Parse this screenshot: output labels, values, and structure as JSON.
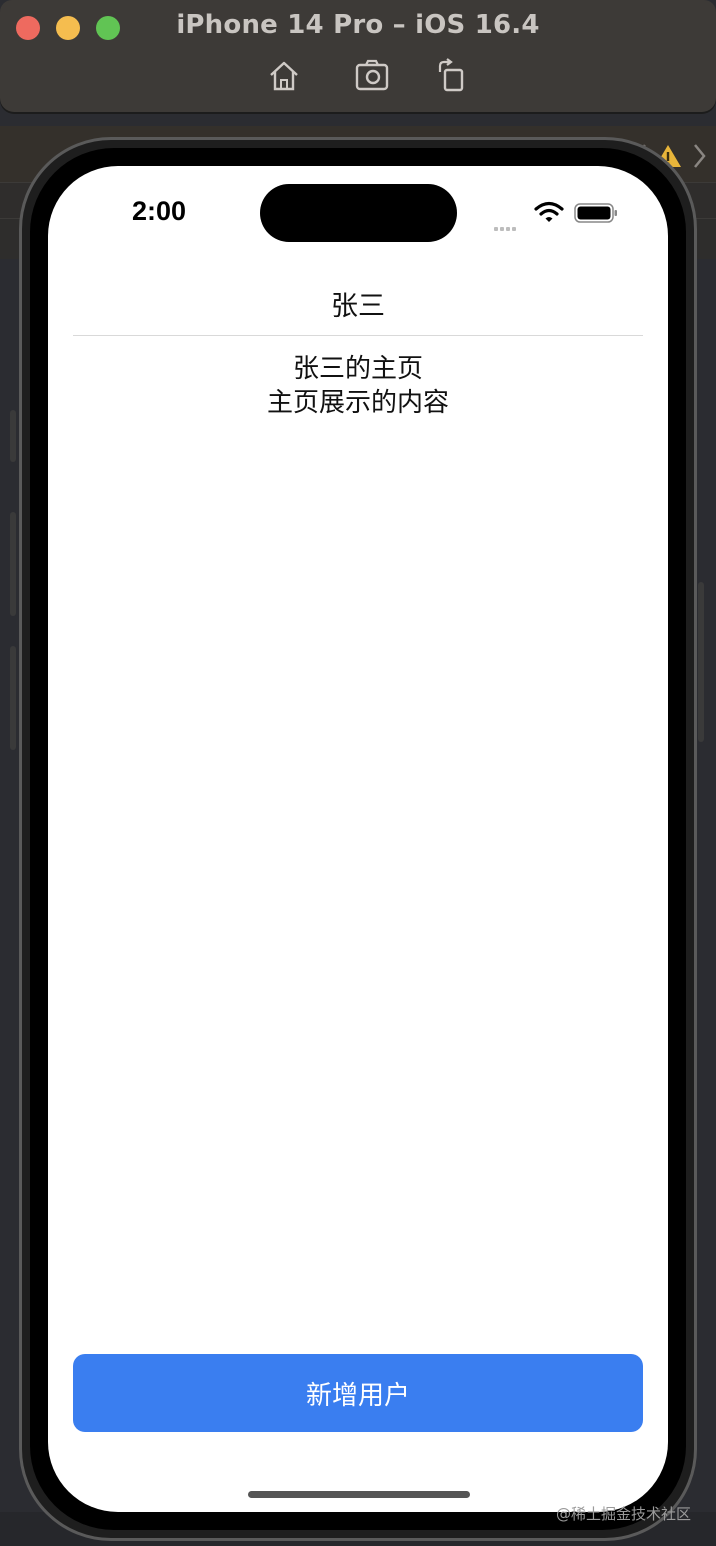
{
  "window": {
    "title": "iPhone 14 Pro – iOS 16.4",
    "toolbar_icons": [
      "home-icon",
      "screenshot-icon",
      "rotate-icon"
    ]
  },
  "status_bar": {
    "time": "2:00",
    "icons": [
      "signal-icon",
      "wifi-icon",
      "battery-icon"
    ]
  },
  "nav": {
    "title": "张三"
  },
  "content": {
    "line1": "张三的主页",
    "line2": "主页展示的内容"
  },
  "footer": {
    "button_label": "新增用户"
  },
  "watermark": "@稀土掘金技术社区",
  "colors": {
    "button": "#3a7ef0",
    "screen_bg": "#ffffff",
    "window_bg": "#3d3a37"
  }
}
